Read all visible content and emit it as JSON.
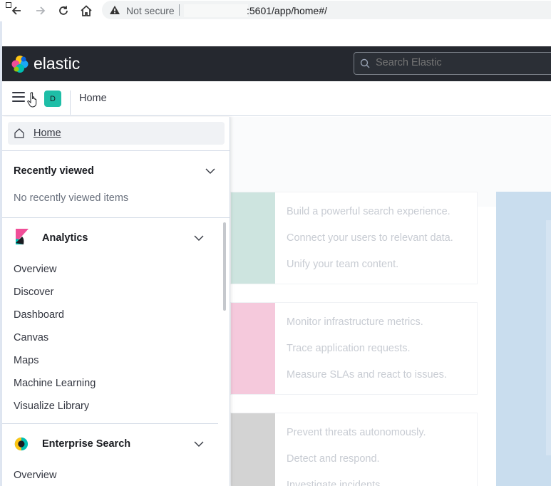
{
  "browser": {
    "not_secure": "Not secure",
    "url": ":5601/app/home#/"
  },
  "header": {
    "brand": "elastic",
    "search_placeholder": "Search Elastic"
  },
  "breadcrumb": {
    "space_initial": "D",
    "current": "Home"
  },
  "nav": {
    "home_label": "Home",
    "recently_viewed": {
      "title": "Recently viewed",
      "empty": "No recently viewed items"
    },
    "analytics": {
      "title": "Analytics",
      "items": [
        "Overview",
        "Discover",
        "Dashboard",
        "Canvas",
        "Maps",
        "Machine Learning",
        "Visualize Library"
      ]
    },
    "enterprise_search": {
      "title": "Enterprise Search",
      "items": [
        "Overview"
      ]
    }
  },
  "background_cards": [
    {
      "color": "#cde4df",
      "lines": [
        "Build a powerful search experience.",
        "Connect your users to relevant data.",
        "Unify your team content."
      ]
    },
    {
      "color": "#f5c9dc",
      "lines": [
        "Monitor infrastructure metrics.",
        "Trace application requests.",
        "Measure SLAs and react to issues."
      ]
    },
    {
      "color": "#d3d3d3",
      "lines": [
        "Prevent threats autonomously.",
        "Detect and respond.",
        "Investigate incidents."
      ]
    }
  ],
  "colors": {
    "header_bg": "#25282f",
    "accent_teal": "#1ebea7"
  }
}
